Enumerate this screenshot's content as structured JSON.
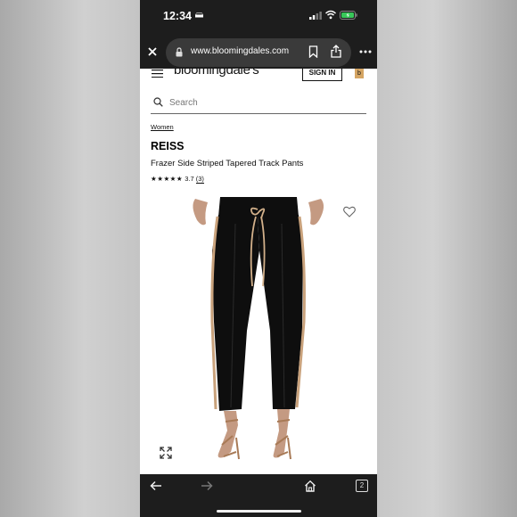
{
  "status_bar": {
    "time": "12:34"
  },
  "browser": {
    "url": "www.bloomingdales.com"
  },
  "site": {
    "logo": "bloomingdale's",
    "sign_in": "SIGN IN",
    "bag_letter": "b",
    "search_placeholder": "Search"
  },
  "product": {
    "breadcrumb": "Women",
    "brand": "REISS",
    "name": "Frazer Side Striped Tapered Track Pants",
    "stars": "★★★★★",
    "rating": "3.7",
    "review_count": "(3)"
  },
  "bottom_bar": {
    "tab_count": "2"
  },
  "colors": {
    "phone_chrome": "#1d1d1d",
    "url_pill": "#3a3a3a",
    "bag_accent": "#d5a563",
    "battery_green": "#38c759",
    "pants": "#0e0e0e",
    "stripe": "#c9a27c"
  }
}
